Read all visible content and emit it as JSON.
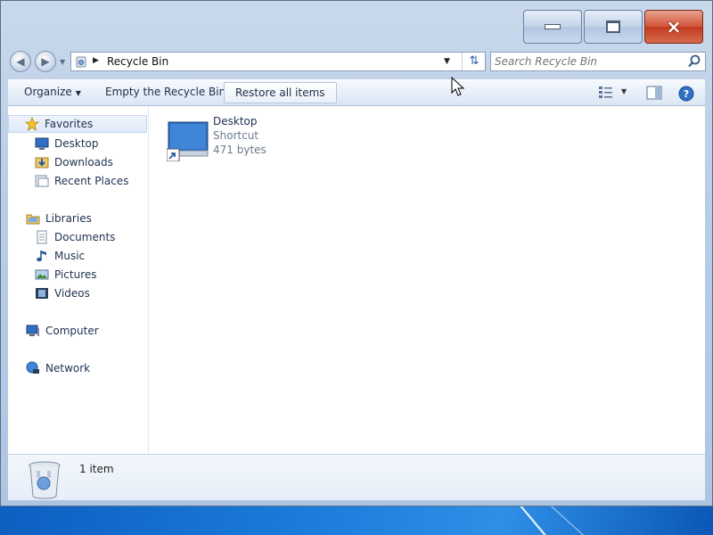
{
  "window": {
    "caption_buttons": {
      "minimize": "minimize-icon",
      "maximize": "maximize-icon",
      "close": "×"
    }
  },
  "navigation": {
    "back": "back-arrow-icon",
    "forward": "forward-arrow-icon"
  },
  "address_bar": {
    "breadcrumb": "Recycle Bin",
    "dropdown": "chevron-down-icon",
    "refresh": "refresh-icon"
  },
  "search": {
    "placeholder": "Search Recycle Bin",
    "value": ""
  },
  "toolbar": {
    "organize_label": "Organize",
    "empty_label": "Empty the Recycle Bin",
    "restore_label": "Restore all items",
    "icons": [
      "view-options-icon",
      "preview-pane-icon",
      "help-icon"
    ]
  },
  "sidebar": {
    "favorites": {
      "label": "Favorites",
      "items": [
        {
          "label": "Desktop",
          "icon": "desktop-icon"
        },
        {
          "label": "Downloads",
          "icon": "downloads-icon"
        },
        {
          "label": "Recent Places",
          "icon": "recent-places-icon"
        }
      ]
    },
    "libraries": {
      "label": "Libraries",
      "items": [
        {
          "label": "Documents",
          "icon": "documents-icon"
        },
        {
          "label": "Music",
          "icon": "music-icon"
        },
        {
          "label": "Pictures",
          "icon": "pictures-icon"
        },
        {
          "label": "Videos",
          "icon": "videos-icon"
        }
      ]
    },
    "computer": {
      "label": "Computer"
    },
    "network": {
      "label": "Network"
    }
  },
  "files": [
    {
      "name": "Desktop",
      "type": "Shortcut",
      "size": "471 bytes",
      "icon": "desktop-shortcut-icon"
    }
  ],
  "details": {
    "count": "1 item",
    "icon": "recycle-bin-icon"
  },
  "colors": {
    "link": "#1e3150",
    "secondary_text": "#6d7b8c",
    "close_red": "#c23a1f",
    "frame": "#b9cde6"
  }
}
